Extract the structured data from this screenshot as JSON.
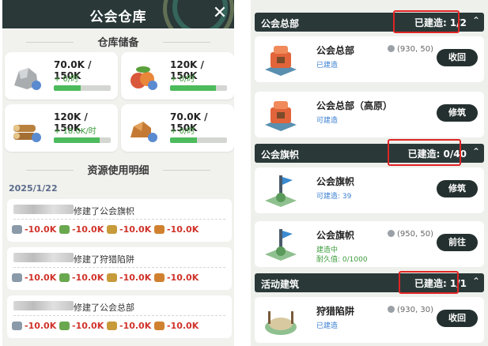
{
  "left": {
    "title": "公会仓库",
    "close_glyph": "✕",
    "storage_title": "仓库储备",
    "resources": [
      {
        "icon": "stone-icon",
        "amount": "70.0K / 150K",
        "rate": "+ 0/时",
        "fill": 0.47
      },
      {
        "icon": "fruit-icon",
        "amount": "120K / 150K",
        "rate": "+ 0/时",
        "fill": 0.8
      },
      {
        "icon": "wood-icon",
        "amount": "120K / 150K",
        "rate": "+ 18.0K/时",
        "fill": 0.8
      },
      {
        "icon": "ore-icon",
        "amount": "70.0K / 150K",
        "rate": "+ 0/时",
        "fill": 0.47
      }
    ],
    "usage_title": "资源使用明细",
    "date": "2025/1/22",
    "logs": [
      {
        "message": "修建了公会旗帜",
        "costs": [
          "-10.0K",
          "-10.0K",
          "-10.0K",
          "-10.0K"
        ]
      },
      {
        "message": "修建了狩猎陷阱",
        "costs": [
          "-10.0K",
          "-10.0K",
          "-10.0K",
          "-10.0K"
        ]
      },
      {
        "message": "修建了公会总部",
        "costs": [
          "-10.0K",
          "-10.0K",
          "-10.0K",
          "-10.0K"
        ]
      }
    ],
    "cost_colors": [
      "#8a9aa8",
      "#6aa84f",
      "#c79a3a",
      "#d0812f"
    ]
  },
  "right": {
    "categories": [
      {
        "name": "公会总部",
        "count": "已建造: 1/2"
      },
      {
        "name": "公会旗帜",
        "count": "已建造: 0/40"
      },
      {
        "name": "活动建筑",
        "count": "已建造: 1/1"
      }
    ],
    "chevron": "⌃",
    "buildings": [
      {
        "name": "公会总部",
        "coord": "(930, 50)",
        "status": "已建造",
        "status2": "",
        "button": "收回"
      },
      {
        "name": "公会总部（高原）",
        "coord": "",
        "status": "可建造",
        "status2": "",
        "button": "修筑"
      },
      {
        "name": "公会旗帜",
        "coord": "",
        "status": "可建造: 39",
        "status2": "",
        "button": "修筑"
      },
      {
        "name": "公会旗帜",
        "coord": "(950, 50)",
        "status": "建造中",
        "status2": "耐久值: 0/1000",
        "button": "前往"
      },
      {
        "name": "狩猎陷阱",
        "coord": "(930, 30)",
        "status": "已建造",
        "status2": "",
        "button": "收回"
      }
    ]
  }
}
